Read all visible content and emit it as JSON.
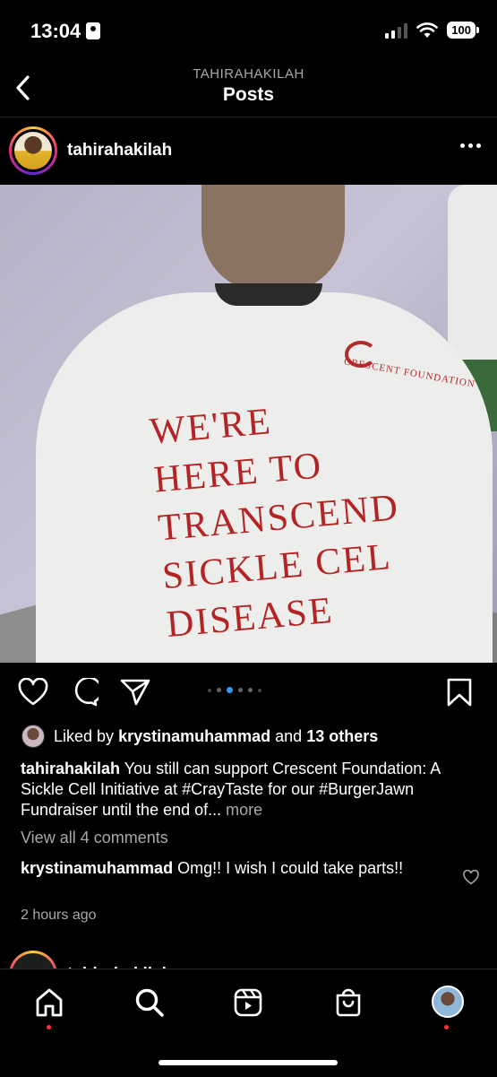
{
  "status_bar": {
    "time": "13:04",
    "battery": "100"
  },
  "header": {
    "subtitle": "TAHIRAHAKILAH",
    "title": "Posts"
  },
  "post": {
    "username": "tahirahakilah",
    "photo_text": {
      "logo": "CRESCENT FOUNDATION",
      "lines": [
        "WE'RE",
        "HERE TO",
        "TRANSCEND",
        "SICKLE CEL",
        "DISEASE"
      ]
    },
    "carousel": {
      "count": 6,
      "active_index": 2
    },
    "likes": {
      "prefix": "Liked by",
      "user": "krystinamuhammad",
      "middle": "and",
      "others": "13 others"
    },
    "caption": {
      "username": "tahirahakilah",
      "text": "You still can support Crescent Foundation: A Sickle Cell Initiative at #CrayTaste for our #BurgerJawn Fundraiser until the end of...",
      "more": "more"
    },
    "view_comments": "View all 4 comments",
    "comment": {
      "username": "krystinamuhammad",
      "text": "Omg!! I wish I could take parts!!"
    },
    "timestamp": "2 hours ago"
  },
  "next_post": {
    "username": "tahirahakilah"
  },
  "colors": {
    "background": "#000000",
    "accent_blue": "#3897f0",
    "notification_red": "#ff3040",
    "shirt_text": "#b52424"
  },
  "tabbar": {
    "items": [
      "home-icon",
      "search-icon",
      "reels-icon",
      "shop-icon",
      "profile-avatar"
    ]
  }
}
